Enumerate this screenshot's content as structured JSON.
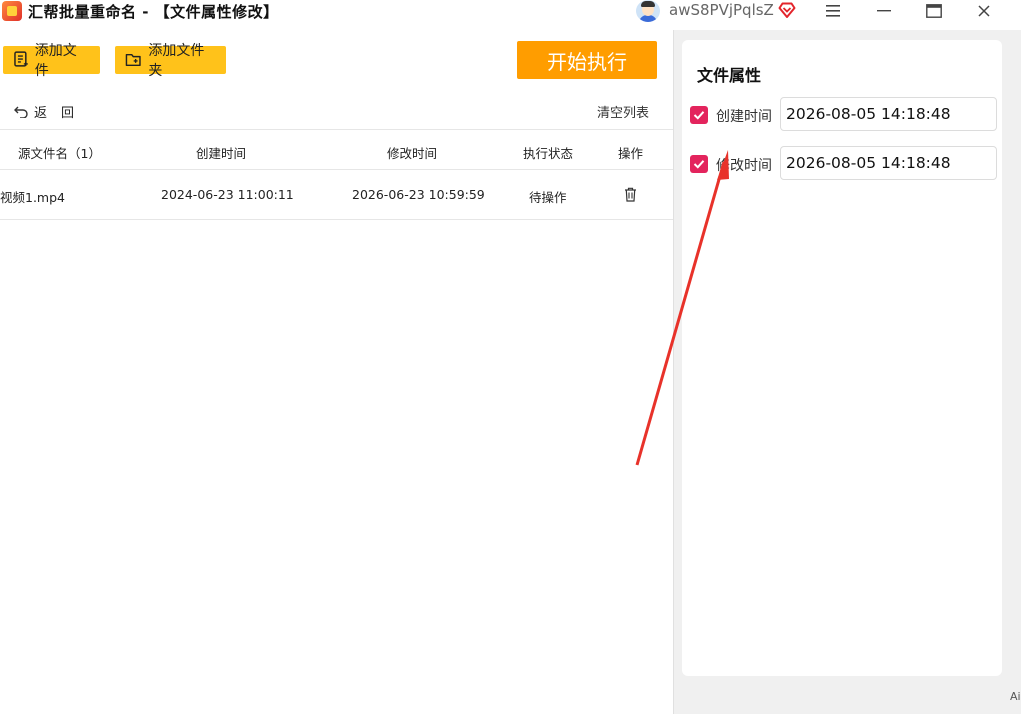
{
  "window": {
    "title": "汇帮批量重命名 - 【文件属性修改】",
    "username": "awS8PVjPqlsZ"
  },
  "toolbar": {
    "add_file": "添加文件",
    "add_folder": "添加文件夹",
    "start": "开始执行",
    "back": "返回",
    "clear_list": "清空列表"
  },
  "table": {
    "headers": {
      "name": "源文件名（1）",
      "created": "创建时间",
      "modified": "修改时间",
      "status": "执行状态",
      "action": "操作"
    },
    "rows": [
      {
        "name": "视频1.mp4",
        "created": "2024-06-23 11:00:11",
        "modified": "2026-06-23 10:59:59",
        "status": "待操作"
      }
    ]
  },
  "properties": {
    "title": "文件属性",
    "created_label": "创建时间",
    "created_value": "2026-08-05 14:18:48",
    "created_checked": true,
    "modified_label": "修改时间",
    "modified_value": "2026-08-05 14:18:48",
    "modified_checked": true
  },
  "edge_text": "Ai",
  "colors": {
    "accent_yellow": "#ffc21a",
    "start_orange": "#ff9d00",
    "checkbox": "#e3245d",
    "arrow": "#e8322a"
  }
}
